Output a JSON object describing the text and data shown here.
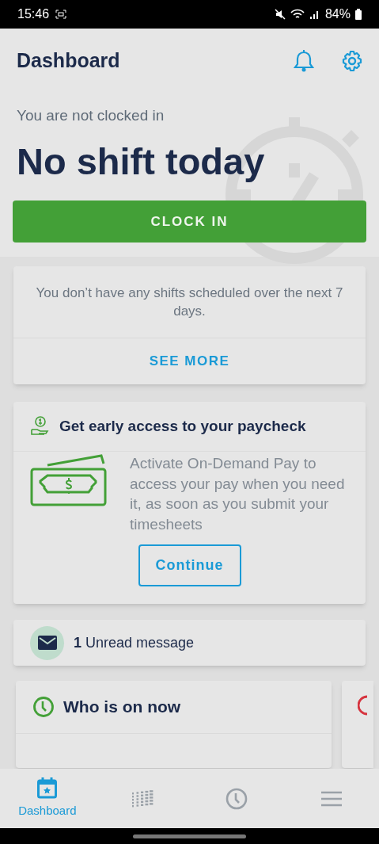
{
  "status_bar": {
    "time": "15:46",
    "battery": "84%"
  },
  "header": {
    "title": "Dashboard"
  },
  "clock": {
    "status": "You are not clocked in",
    "headline": "No shift today",
    "button": "CLOCK IN"
  },
  "schedule_card": {
    "message": "You don’t have any shifts scheduled over the next 7 days.",
    "link": "SEE MORE"
  },
  "pay_card": {
    "title": "Get early access to your paycheck",
    "body": "Activate On-Demand Pay to access your pay when you need it, as soon as you submit your timesheets",
    "button": "Continue"
  },
  "messages": {
    "text": "**1** Unread message"
  },
  "who_card": {
    "title": "Who is on now"
  },
  "bottom_nav": [
    {
      "kind": "calendar",
      "label": "Dashboard",
      "selected": true
    },
    {
      "kind": "grid",
      "selected": false
    },
    {
      "kind": "clock",
      "selected": false
    },
    {
      "kind": "menu",
      "selected": false
    }
  ]
}
